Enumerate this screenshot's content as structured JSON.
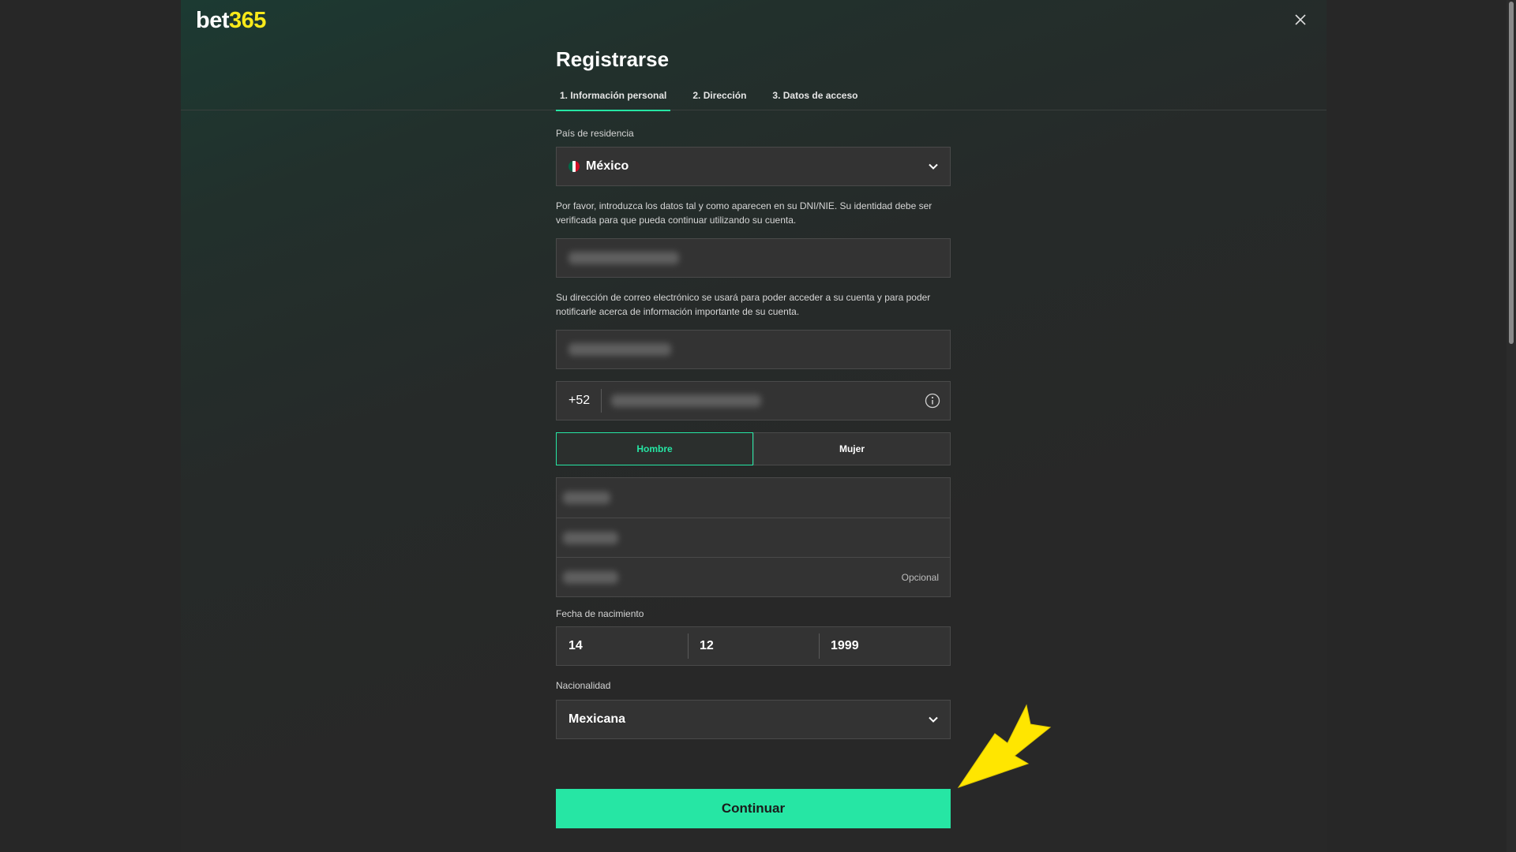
{
  "brand": {
    "name_part1": "bet",
    "name_part2": "365"
  },
  "title": "Registrarse",
  "tabs": [
    {
      "label": "1.  Información personal",
      "active": true
    },
    {
      "label": "2.  Dirección",
      "active": false
    },
    {
      "label": "3.  Datos de acceso",
      "active": false
    }
  ],
  "country": {
    "label": "País de residencia",
    "value": "México",
    "flag_icon": "mexico-flag-icon"
  },
  "identity_note": "Por favor, introduzca los datos tal y como aparecen en su DNI/NIE. Su identidad debe ser verificada para que pueda continuar utilizando su cuenta.",
  "email_note": "Su dirección de correo electrónico se usará para poder acceder a su cuenta y para poder notificarle acerca de información importante de su cuenta.",
  "phone": {
    "prefix": "+52"
  },
  "gender": {
    "options": [
      "Hombre",
      "Mujer"
    ],
    "selected": "Hombre"
  },
  "surname_optional_label": "Opcional",
  "dob": {
    "label": "Fecha de nacimiento",
    "day": "14",
    "month": "12",
    "year": "1999"
  },
  "nationality": {
    "label": "Nacionalidad",
    "value": "Mexicana"
  },
  "continue_label": "Continuar",
  "colors": {
    "accent": "#26e6a4",
    "logo_yellow": "#f8e91a",
    "annotation_arrow": "#ffe600"
  }
}
